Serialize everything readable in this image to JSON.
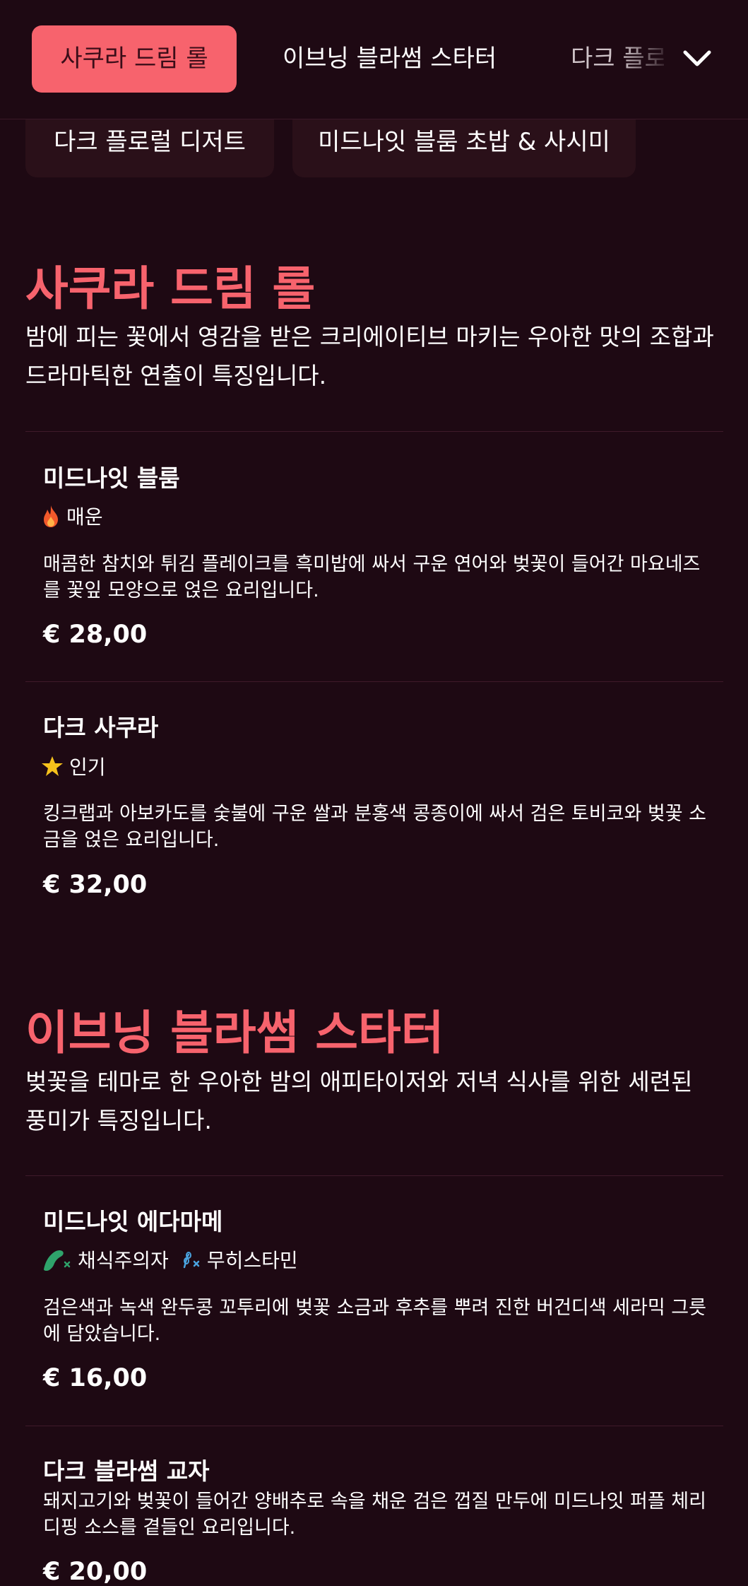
{
  "nav": {
    "tabs": [
      {
        "label": "사쿠라 드림 롤"
      },
      {
        "label": "이브닝 블라썸 스타터"
      },
      {
        "label": "다크 플로럴 디저트"
      }
    ],
    "chips": [
      {
        "label": "다크 플로럴 디저트"
      },
      {
        "label": "미드나잇 블룸 초밥 & 사시미"
      }
    ],
    "expand_icon": "chevron-down-icon"
  },
  "sections": [
    {
      "title": "사쿠라 드림 롤",
      "description": "밤에 피는 꽃에서 영감을 받은 크리에이티브 마키는 우아한 맛의 조합과 드라마틱한 연출이 특징입니다.",
      "items": [
        {
          "name": "미드나잇 블룸",
          "tags": [
            {
              "icon": "fire-icon",
              "label": "매운"
            }
          ],
          "description": "매콤한 참치와 튀김 플레이크를 흑미밥에 싸서 구운 연어와 벚꽃이 들어간 마요네즈를 꽃잎 모양으로 얹은 요리입니다.",
          "price": "€ 28,00"
        },
        {
          "name": "다크 사쿠라",
          "tags": [
            {
              "icon": "star-icon",
              "label": "인기"
            }
          ],
          "description": "킹크랩과 아보카도를 숯불에 구운 쌀과 분홍색 콩종이에 싸서 검은 토비코와 벚꽃 소금을 얹은 요리입니다.",
          "price": "€ 32,00"
        }
      ]
    },
    {
      "title": "이브닝 블라썸 스타터",
      "description": "벚꽃을 테마로 한 우아한 밤의 애피타이저와 저녁 식사를 위한 세련된 풍미가 특징입니다.",
      "items": [
        {
          "name": "미드나잇 에다마메",
          "tags": [
            {
              "icon": "vegetarian-icon",
              "label": "채식주의자"
            },
            {
              "icon": "gluten-free-icon",
              "label": "무히스타민"
            }
          ],
          "description": "검은색과 녹색 완두콩 꼬투리에 벚꽃 소금과 후추를 뿌려 진한 버건디색 세라믹 그릇에 담았습니다.",
          "price": "€ 16,00"
        },
        {
          "name": "다크 블라썸 교자",
          "tags": [],
          "description": "돼지고기와 벚꽃이 들어간 양배추로 속을 채운 검은 껍질 만두에 미드나잇 퍼플 체리 디핑 소스를 곁들인 요리입니다.",
          "price": "€ 20,00"
        }
      ]
    }
  ],
  "colors": {
    "background": "#1e0913",
    "accent": "#f7636d",
    "active_tab_text": "#3b0d18"
  }
}
